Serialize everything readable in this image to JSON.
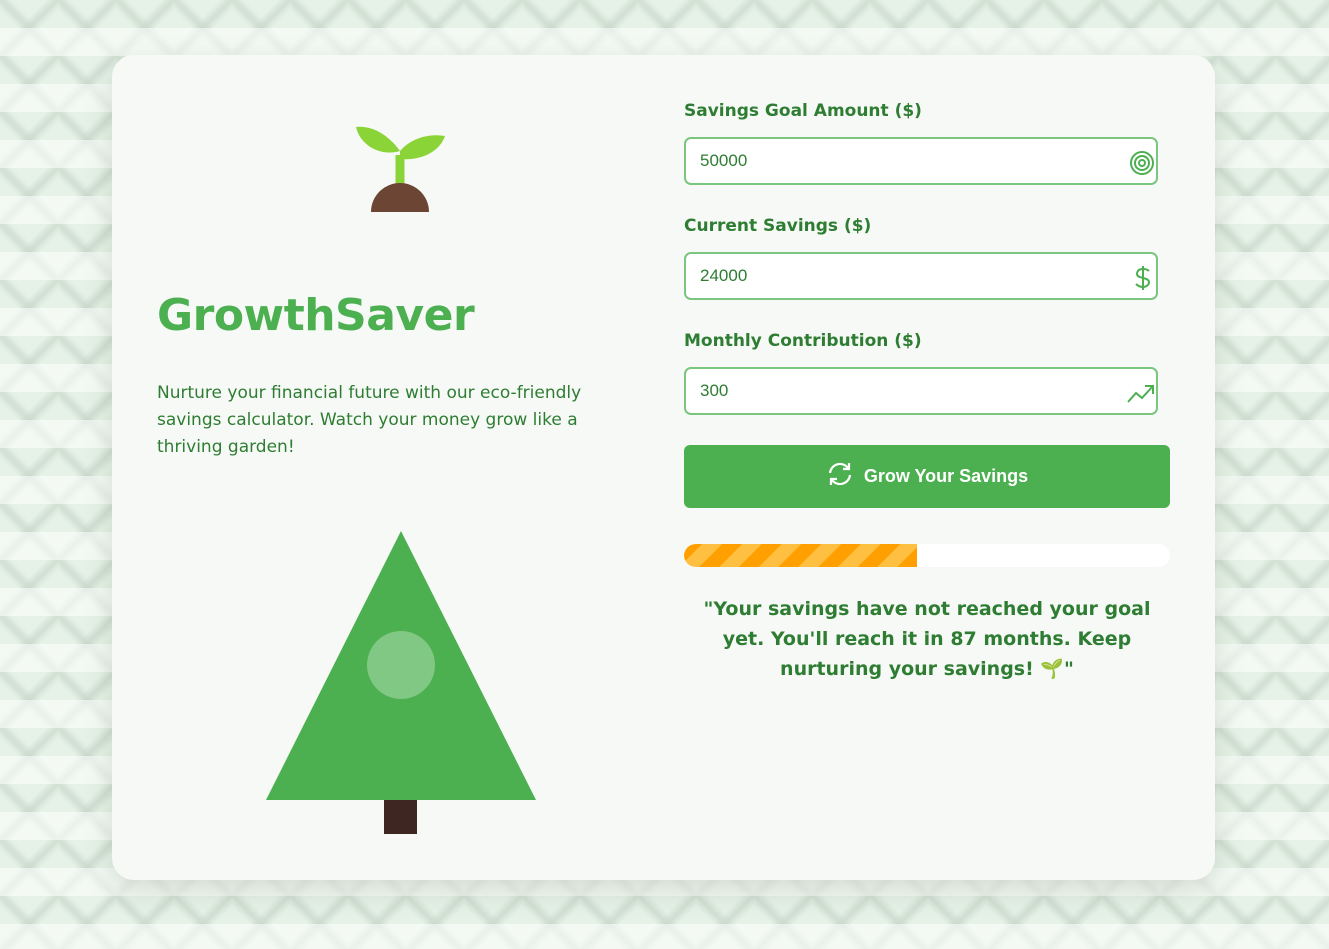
{
  "app": {
    "title": "GrowthSaver",
    "description": "Nurture your financial future with our eco-friendly savings calculator. Watch your money grow like a thriving garden!"
  },
  "form": {
    "goal": {
      "label": "Savings Goal Amount ($)",
      "value": "50000",
      "icon": "target-icon"
    },
    "current": {
      "label": "Current Savings ($)",
      "value": "24000",
      "icon": "dollar-icon"
    },
    "monthly": {
      "label": "Monthly Contribution ($)",
      "value": "300",
      "icon": "trending-up-icon"
    }
  },
  "button": {
    "label": "Grow Your Savings",
    "icon": "refresh-icon"
  },
  "progress": {
    "fraction": 0.48
  },
  "result": {
    "message": "\"Your savings have not reached your goal yet. You'll reach it in 87 months. Keep nurturing your savings! 🌱\""
  },
  "colors": {
    "primary": "#4caf50",
    "dark_green": "#2e7d32",
    "progress": "#ff9f00",
    "soil": "#6d4534",
    "trunk": "#3e2723"
  }
}
